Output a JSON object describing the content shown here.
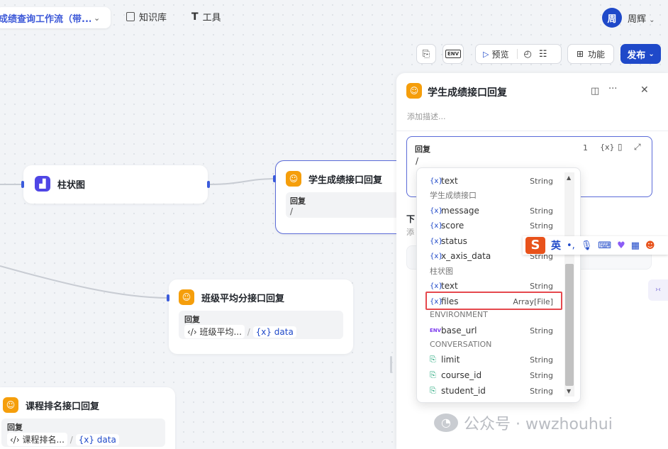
{
  "header": {
    "workflow_title": "成绩查询工作流（带...",
    "knowledge_base": "知识库",
    "tools": "工具",
    "user_avatar_char": "周",
    "user_name": "周辉"
  },
  "toolbar": {
    "preview": "预览",
    "features": "功能",
    "publish": "发布"
  },
  "nodes": {
    "bar_chart": {
      "title": "柱状图"
    },
    "score_reply": {
      "title": "学生成绩接口回复",
      "reply_label": "回复",
      "reply_value": "/"
    },
    "class_avg": {
      "title": "班级平均分接口回复",
      "reply_label": "回复",
      "chip": "班级平均...",
      "sep": "/",
      "var": "{x} data"
    },
    "course_rank": {
      "title": "课程排名接口回复",
      "reply_label": "回复",
      "chip": "课程排名...",
      "sep": "/",
      "var": "{x} data"
    }
  },
  "panel": {
    "title": "学生成绩接口回复",
    "description_placeholder": "添加描述...",
    "field_label": "回复",
    "counter": "1",
    "var_icon_label": "{x}",
    "input_value": "/",
    "below_label": "下",
    "below_sub": "添"
  },
  "dropdown": {
    "groups": [
      {
        "label": "学生成绩接口"
      },
      {
        "label": "柱状图"
      },
      {
        "label": "ENVIRONMENT"
      },
      {
        "label": "CONVERSATION"
      }
    ],
    "items": [
      {
        "name": "text",
        "type": "String",
        "kind": "var"
      },
      {
        "name": "message",
        "type": "String",
        "kind": "var"
      },
      {
        "name": "score",
        "type": "String",
        "kind": "var"
      },
      {
        "name": "status",
        "type": "String",
        "kind": "var"
      },
      {
        "name": "x_axis_data",
        "type": "String",
        "kind": "var"
      },
      {
        "name": "text",
        "type": "String",
        "kind": "var"
      },
      {
        "name": "files",
        "type": "Array[File]",
        "kind": "var",
        "selected": true
      },
      {
        "name": "base_url",
        "type": "String",
        "kind": "env"
      },
      {
        "name": "limit",
        "type": "String",
        "kind": "conv"
      },
      {
        "name": "course_id",
        "type": "String",
        "kind": "conv"
      },
      {
        "name": "student_id",
        "type": "String",
        "kind": "conv"
      }
    ]
  },
  "ime": {
    "brand": "S",
    "mode": "英",
    "punct": "•,"
  },
  "watermark": {
    "text": "公众号 · wwzhouhui"
  },
  "colors": {
    "accent": "#1f49c9",
    "node_icon": "#f59e0b",
    "highlight": "#e5484d"
  }
}
